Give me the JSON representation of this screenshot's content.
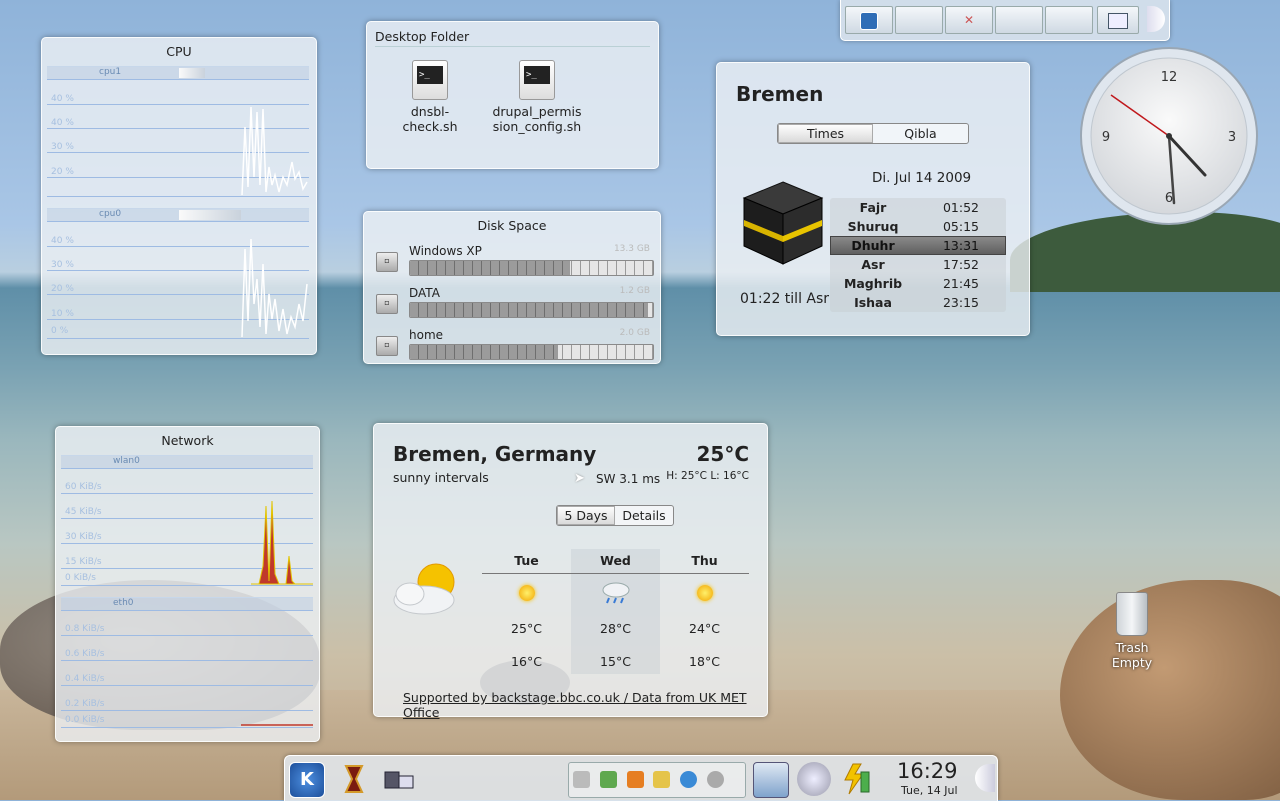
{
  "cpu": {
    "title": "CPU",
    "cores": [
      {
        "label": "cpu1",
        "load_fraction": 0.1
      },
      {
        "label": "cpu0",
        "load_fraction": 0.24
      }
    ],
    "axis_labels": [
      "40 %",
      "40 %",
      "30 %",
      "20 %",
      "10 %",
      "0 %"
    ]
  },
  "desktop_folder": {
    "title": "Desktop Folder",
    "files": [
      {
        "line1": "dnsbl-",
        "line2": "check.sh"
      },
      {
        "line1": "drupal_permis",
        "line2": "sion_config.sh"
      }
    ]
  },
  "disk_space": {
    "title": "Disk Space",
    "drives": [
      {
        "name": "Windows XP",
        "size": "13.3 GB",
        "used_fraction": 0.66
      },
      {
        "name": "DATA",
        "size": "1.2 GB",
        "used_fraction": 0.98
      },
      {
        "name": "home",
        "size": "2.0 GB",
        "used_fraction": 0.61
      }
    ]
  },
  "prayer": {
    "city": "Bremen",
    "tabs": [
      "Times",
      "Qibla"
    ],
    "date": "Di. Jul 14 2009",
    "times": [
      {
        "name": "Fajr",
        "time": "01:52"
      },
      {
        "name": "Shuruq",
        "time": "05:15"
      },
      {
        "name": "Dhuhr",
        "time": "13:31"
      },
      {
        "name": "Asr",
        "time": "17:52"
      },
      {
        "name": "Maghrib",
        "time": "21:45"
      },
      {
        "name": "Ishaa",
        "time": "23:15"
      }
    ],
    "till": "01:22 till Asr"
  },
  "analog_clock": {
    "numerals": [
      "12",
      "3",
      "6",
      "9"
    ]
  },
  "network": {
    "title": "Network",
    "ifaces": [
      {
        "label": "wlan0"
      },
      {
        "label": "eth0"
      }
    ],
    "upper_labels": [
      "60 KiB/s",
      "45 KiB/s",
      "30 KiB/s",
      "15 KiB/s",
      "0 KiB/s"
    ],
    "lower_labels": [
      "0.8 KiB/s",
      "0.6 KiB/s",
      "0.4 KiB/s",
      "0.2 KiB/s",
      "0.0 KiB/s"
    ]
  },
  "weather": {
    "location": "Bremen, Germany",
    "temperature": "25°C",
    "condition": "sunny intervals",
    "wind": "SW 3.1 ms",
    "hilo": "H: 25°C L: 16°C",
    "tabs": [
      "5 Days",
      "Details"
    ],
    "forecast": [
      {
        "day": "Tue",
        "icon": "sun-icon",
        "high": "25°C",
        "low": "16°C"
      },
      {
        "day": "Wed",
        "icon": "rain-cloud-icon",
        "high": "28°C",
        "low": "15°C"
      },
      {
        "day": "Thu",
        "icon": "sun-icon",
        "high": "24°C",
        "low": "18°C"
      }
    ],
    "credit": "Supported by backstage.bbc.co.uk / Data from UK MET Office"
  },
  "trash": {
    "line1": "Trash",
    "line2": "Empty"
  },
  "taskbar": {
    "time": "16:29",
    "date": "Tue, 14 Jul"
  },
  "colors": {
    "accent_blue": "#2f6db6",
    "net_fill": "#c0392b",
    "net_fill_secondary": "#e2c400"
  }
}
